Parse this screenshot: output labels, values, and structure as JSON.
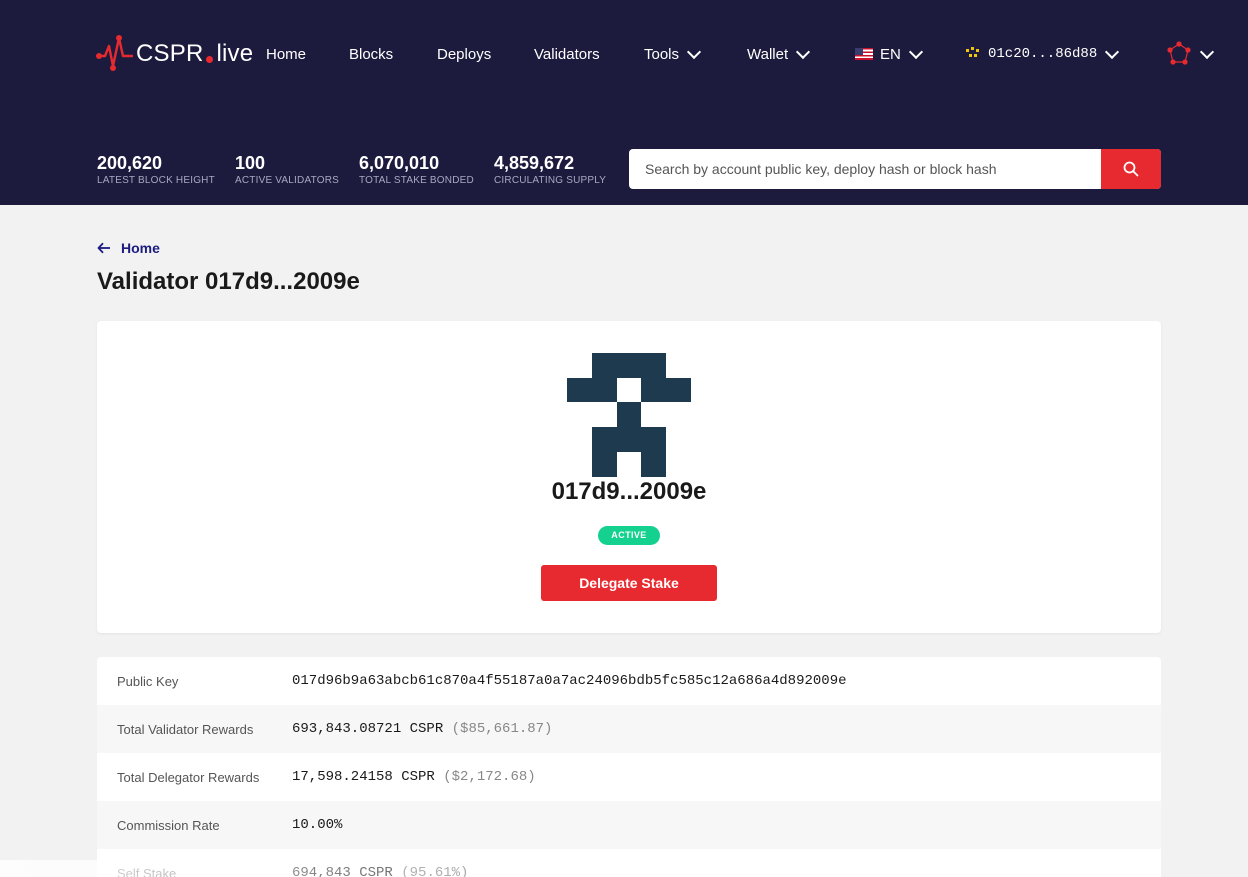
{
  "header": {
    "logo_text": "CSPR",
    "logo_suffix": "live",
    "nav": {
      "home": "Home",
      "blocks": "Blocks",
      "deploys": "Deploys",
      "validators": "Validators",
      "tools": "Tools",
      "wallet": "Wallet",
      "language": "EN",
      "account": "01c20...86d88"
    },
    "stats": [
      {
        "value": "200,620",
        "label": "LATEST BLOCK HEIGHT"
      },
      {
        "value": "100",
        "label": "ACTIVE VALIDATORS"
      },
      {
        "value": "6,070,010",
        "label": "TOTAL STAKE BONDED"
      },
      {
        "value": "4,859,672",
        "label": "CIRCULATING SUPPLY"
      }
    ],
    "search": {
      "placeholder": "Search by account public key, deploy hash or block hash"
    },
    "colors": {
      "background": "#1c1b3e",
      "accent": "#e72a2f"
    }
  },
  "breadcrumb": {
    "label": "Home"
  },
  "page_title": "Validator 017d9...2009e",
  "validator_card": {
    "name": "017d9...2009e",
    "status": "ACTIVE",
    "status_color": "#15d18f",
    "delegate_label": "Delegate Stake",
    "avatar_color": "#1d3a4f"
  },
  "details": [
    {
      "key": "Public Key",
      "value": "017d96b9a63abcb61c870a4f55187a0a7ac24096bdb5fc585c12a686a4d892009e",
      "sub": ""
    },
    {
      "key": "Total Validator Rewards",
      "value": "693,843.08721 CSPR",
      "sub": "($85,661.87)"
    },
    {
      "key": "Total Delegator Rewards",
      "value": "17,598.24158 CSPR",
      "sub": "($2,172.68)"
    },
    {
      "key": "Commission Rate",
      "value": "10.00%",
      "sub": ""
    },
    {
      "key": "Self Stake",
      "value": "694,843 CSPR",
      "sub": "(95.61%)"
    }
  ]
}
